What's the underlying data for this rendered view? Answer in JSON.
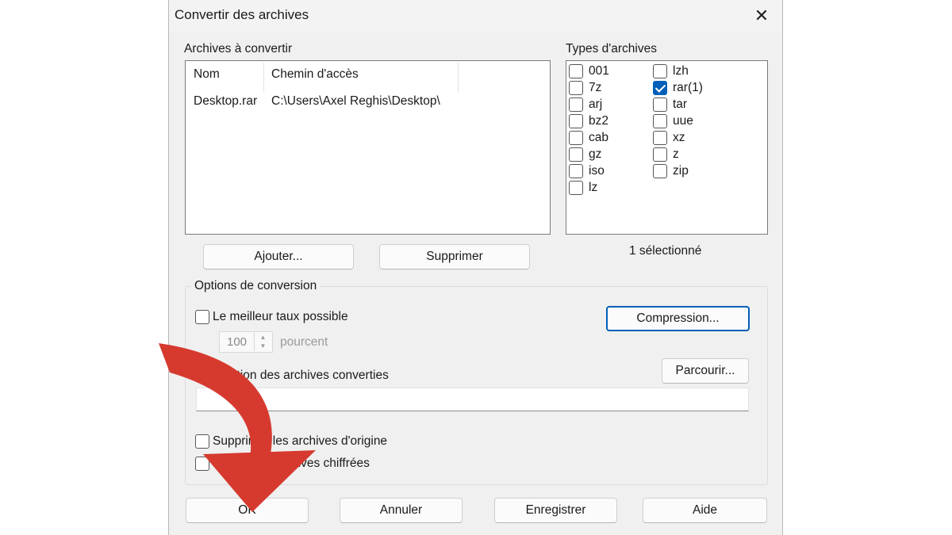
{
  "dialog": {
    "title": "Convertir des archives",
    "close_icon": "close-icon"
  },
  "archives": {
    "label": "Archives à convertir",
    "columns": [
      "Nom",
      "Chemin d'accès"
    ],
    "rows": [
      {
        "name": "Desktop.rar",
        "path": "C:\\Users\\Axel Reghis\\Desktop\\"
      }
    ],
    "add_button": "Ajouter...",
    "remove_button": "Supprimer"
  },
  "types": {
    "label": "Types d'archives",
    "left": [
      {
        "label": "001",
        "checked": false
      },
      {
        "label": "7z",
        "checked": false
      },
      {
        "label": "arj",
        "checked": false
      },
      {
        "label": "bz2",
        "checked": false
      },
      {
        "label": "cab",
        "checked": false
      },
      {
        "label": "gz",
        "checked": false
      },
      {
        "label": "iso",
        "checked": false
      },
      {
        "label": "lz",
        "checked": false
      }
    ],
    "right": [
      {
        "label": "lzh",
        "checked": false
      },
      {
        "label": "rar(1)",
        "checked": true
      },
      {
        "label": "tar",
        "checked": false
      },
      {
        "label": "uue",
        "checked": false
      },
      {
        "label": "xz",
        "checked": false
      },
      {
        "label": "z",
        "checked": false
      },
      {
        "label": "zip",
        "checked": false
      }
    ],
    "selected_count": "1 sélectionné"
  },
  "options": {
    "group_title": "Options de conversion",
    "best_rate_label": "Le meilleur taux possible",
    "best_rate_checked": false,
    "percent_value": "100",
    "percent_unit": "pourcent",
    "compression_button": "Compression...",
    "destination_label": "Destination des archives converties",
    "browse_button": "Parcourir...",
    "destination_value": "",
    "delete_originals_label": "Supprimer les archives d'origine",
    "delete_originals_checked": false,
    "encrypted_label": "Ignorer les archives chiffrées",
    "encrypted_checked": false
  },
  "footer": {
    "ok": "OK",
    "cancel": "Annuler",
    "save": "Enregistrer",
    "help": "Aide"
  },
  "colors": {
    "accent": "#005fb8",
    "annotation_arrow": "#d63a2f",
    "dialog_bg": "#f0f0f0"
  }
}
